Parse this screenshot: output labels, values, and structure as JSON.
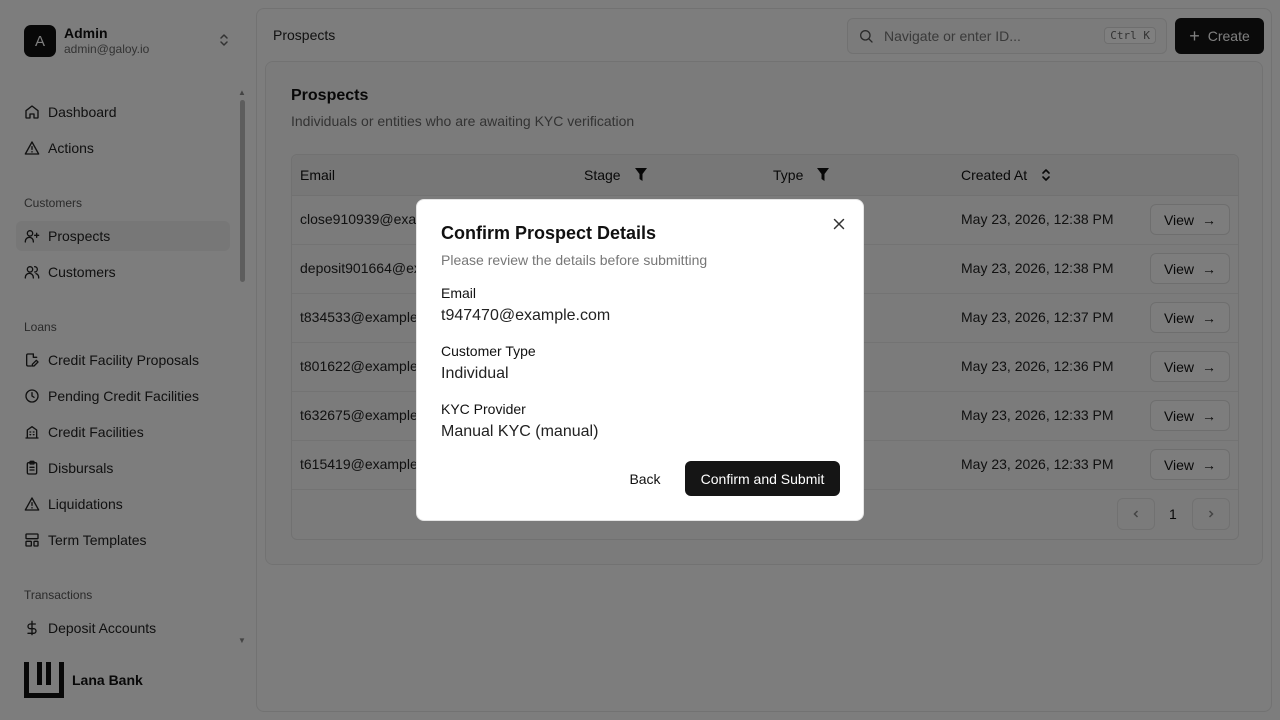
{
  "user": {
    "initial": "A",
    "name": "Admin",
    "email": "admin@galoy.io"
  },
  "nav": {
    "top": [
      {
        "label": "Dashboard",
        "icon": "home-icon"
      },
      {
        "label": "Actions",
        "icon": "alert-triangle-icon"
      }
    ],
    "customers_label": "Customers",
    "customers": [
      {
        "label": "Prospects",
        "icon": "user-plus-icon",
        "active": true
      },
      {
        "label": "Customers",
        "icon": "users-icon"
      }
    ],
    "loans_label": "Loans",
    "loans": [
      {
        "label": "Credit Facility Proposals",
        "icon": "file-edit-icon"
      },
      {
        "label": "Pending Credit Facilities",
        "icon": "clock-icon"
      },
      {
        "label": "Credit Facilities",
        "icon": "building-icon"
      },
      {
        "label": "Disbursals",
        "icon": "clipboard-icon"
      },
      {
        "label": "Liquidations",
        "icon": "alert-triangle-icon"
      },
      {
        "label": "Term Templates",
        "icon": "layout-template-icon"
      }
    ],
    "transactions_label": "Transactions",
    "transactions": [
      {
        "label": "Deposit Accounts",
        "icon": "dollar-icon"
      }
    ]
  },
  "brand": {
    "name": "Lana Bank"
  },
  "topbar": {
    "title": "Prospects",
    "search_placeholder": "Navigate or enter ID...",
    "shortcut": "Ctrl K",
    "create_label": "Create"
  },
  "page": {
    "title": "Prospects",
    "subtitle": "Individuals or entities who are awaiting KYC verification"
  },
  "table": {
    "columns": [
      "Email",
      "Stage",
      "Type",
      "Created At"
    ],
    "rows": [
      {
        "email": "close910939@exam",
        "created": "May 23, 2026, 12:38 PM"
      },
      {
        "email": "deposit901664@ex",
        "created": "May 23, 2026, 12:38 PM"
      },
      {
        "email": "t834533@example",
        "created": "May 23, 2026, 12:37 PM"
      },
      {
        "email": "t801622@example.c",
        "created": "May 23, 2026, 12:36 PM"
      },
      {
        "email": "t632675@example.",
        "created": "May 23, 2026, 12:33 PM"
      },
      {
        "email": "t615419@example.c",
        "created": "May 23, 2026, 12:33 PM"
      }
    ],
    "view_label": "View",
    "page_number": "1"
  },
  "modal": {
    "title": "Confirm Prospect Details",
    "description": "Please review the details before submitting",
    "fields": [
      {
        "label": "Email",
        "value": "t947470@example.com"
      },
      {
        "label": "Customer Type",
        "value": "Individual"
      },
      {
        "label": "KYC Provider",
        "value": "Manual KYC (manual)"
      }
    ],
    "back_label": "Back",
    "submit_label": "Confirm and Submit"
  }
}
